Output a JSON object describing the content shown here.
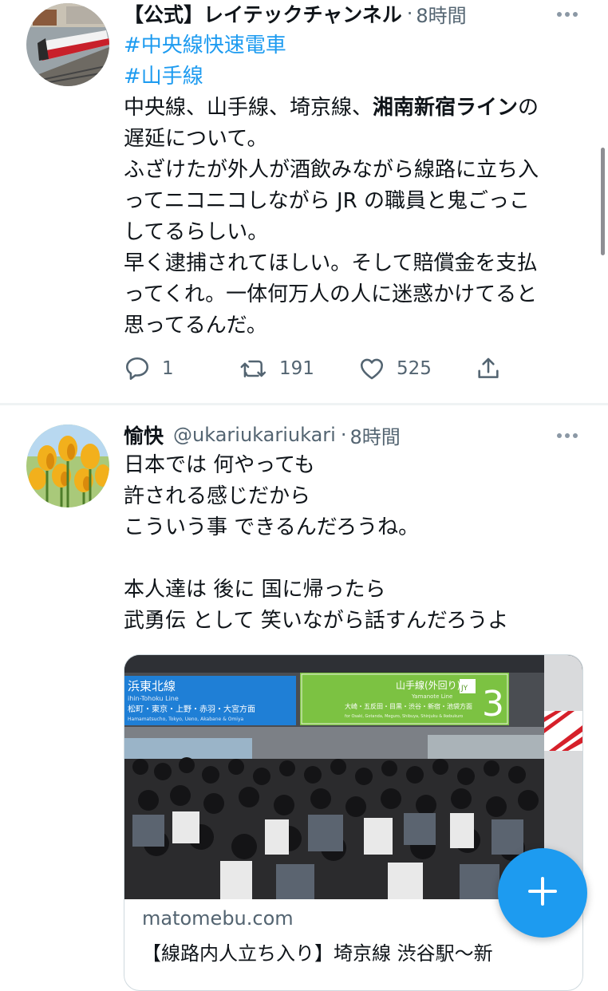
{
  "tweet1": {
    "name": "【公式】レイテックチャンネル",
    "dot": "·",
    "time": "8時間",
    "lines": [
      {
        "hashtag": "#中央線快速電車"
      },
      {
        "hashtag": "#山手線"
      },
      {
        "pre": "中央線、山手線、埼京線、",
        "bold": "湘南新宿ライン",
        "post": "の"
      },
      {
        "text": "遅延について。"
      },
      {
        "text": "ふざけたが外人が酒飲みながら線路に立ち入"
      },
      {
        "text": "ってニコニコしながら JR の職員と鬼ごっこ"
      },
      {
        "text": "してるらしい。"
      },
      {
        "text": "早く逮捕されてほしい。そして賠償金を支払"
      },
      {
        "text": "ってくれ。一体何万人の人に迷惑かけてると"
      },
      {
        "text": "思ってるんだ。"
      }
    ],
    "reply_count": "1",
    "retweet_count": "191",
    "like_count": "525"
  },
  "tweet2": {
    "name": "愉快",
    "handle": "@ukariukariukari",
    "dot": "·",
    "time": "8時間",
    "lines": [
      "日本では 何やっても",
      "許される感じだから",
      "こういう事 できるんだろうね。",
      "",
      "本人達は 後に 国に帰ったら",
      "武勇伝 として 笑いながら話すんだろうよ"
    ],
    "card": {
      "sign_left_title": "浜東北線",
      "sign_left_en": "ihin-Tohoku Line",
      "sign_left_stations": "松町・東京・上野・赤羽・大宮方面",
      "sign_left_stations_en": "Hamamatsucho, Tokyo, Ueno, Akabane & Omiya",
      "sign_right_title": "山手線(外回り)",
      "sign_right_en": "Yamanote Line",
      "sign_right_code": "JY",
      "sign_right_number": "3",
      "sign_right_stations": "大崎・五反田・目黒・渋谷・新宿・池袋方面",
      "sign_right_stations_en": "for Osaki, Gotanda, Meguro, Shibuya, Shinjuku & Ikebukuro",
      "domain": "matomebu.com",
      "title": "【線路内人立ち入り】埼京線 渋谷駅〜新"
    }
  },
  "icons": {
    "reply": "comment-bubble-icon",
    "retweet": "retweet-arrows-icon",
    "like": "heart-outline-icon",
    "share": "share-upload-icon",
    "more": "more-dots-icon",
    "compose": "plus-compose-icon"
  },
  "colors": {
    "link_blue": "#1d9bf0",
    "secondary_text": "#536471",
    "sign_blue": "#1f7fd6",
    "sign_green": "#7cc242"
  }
}
